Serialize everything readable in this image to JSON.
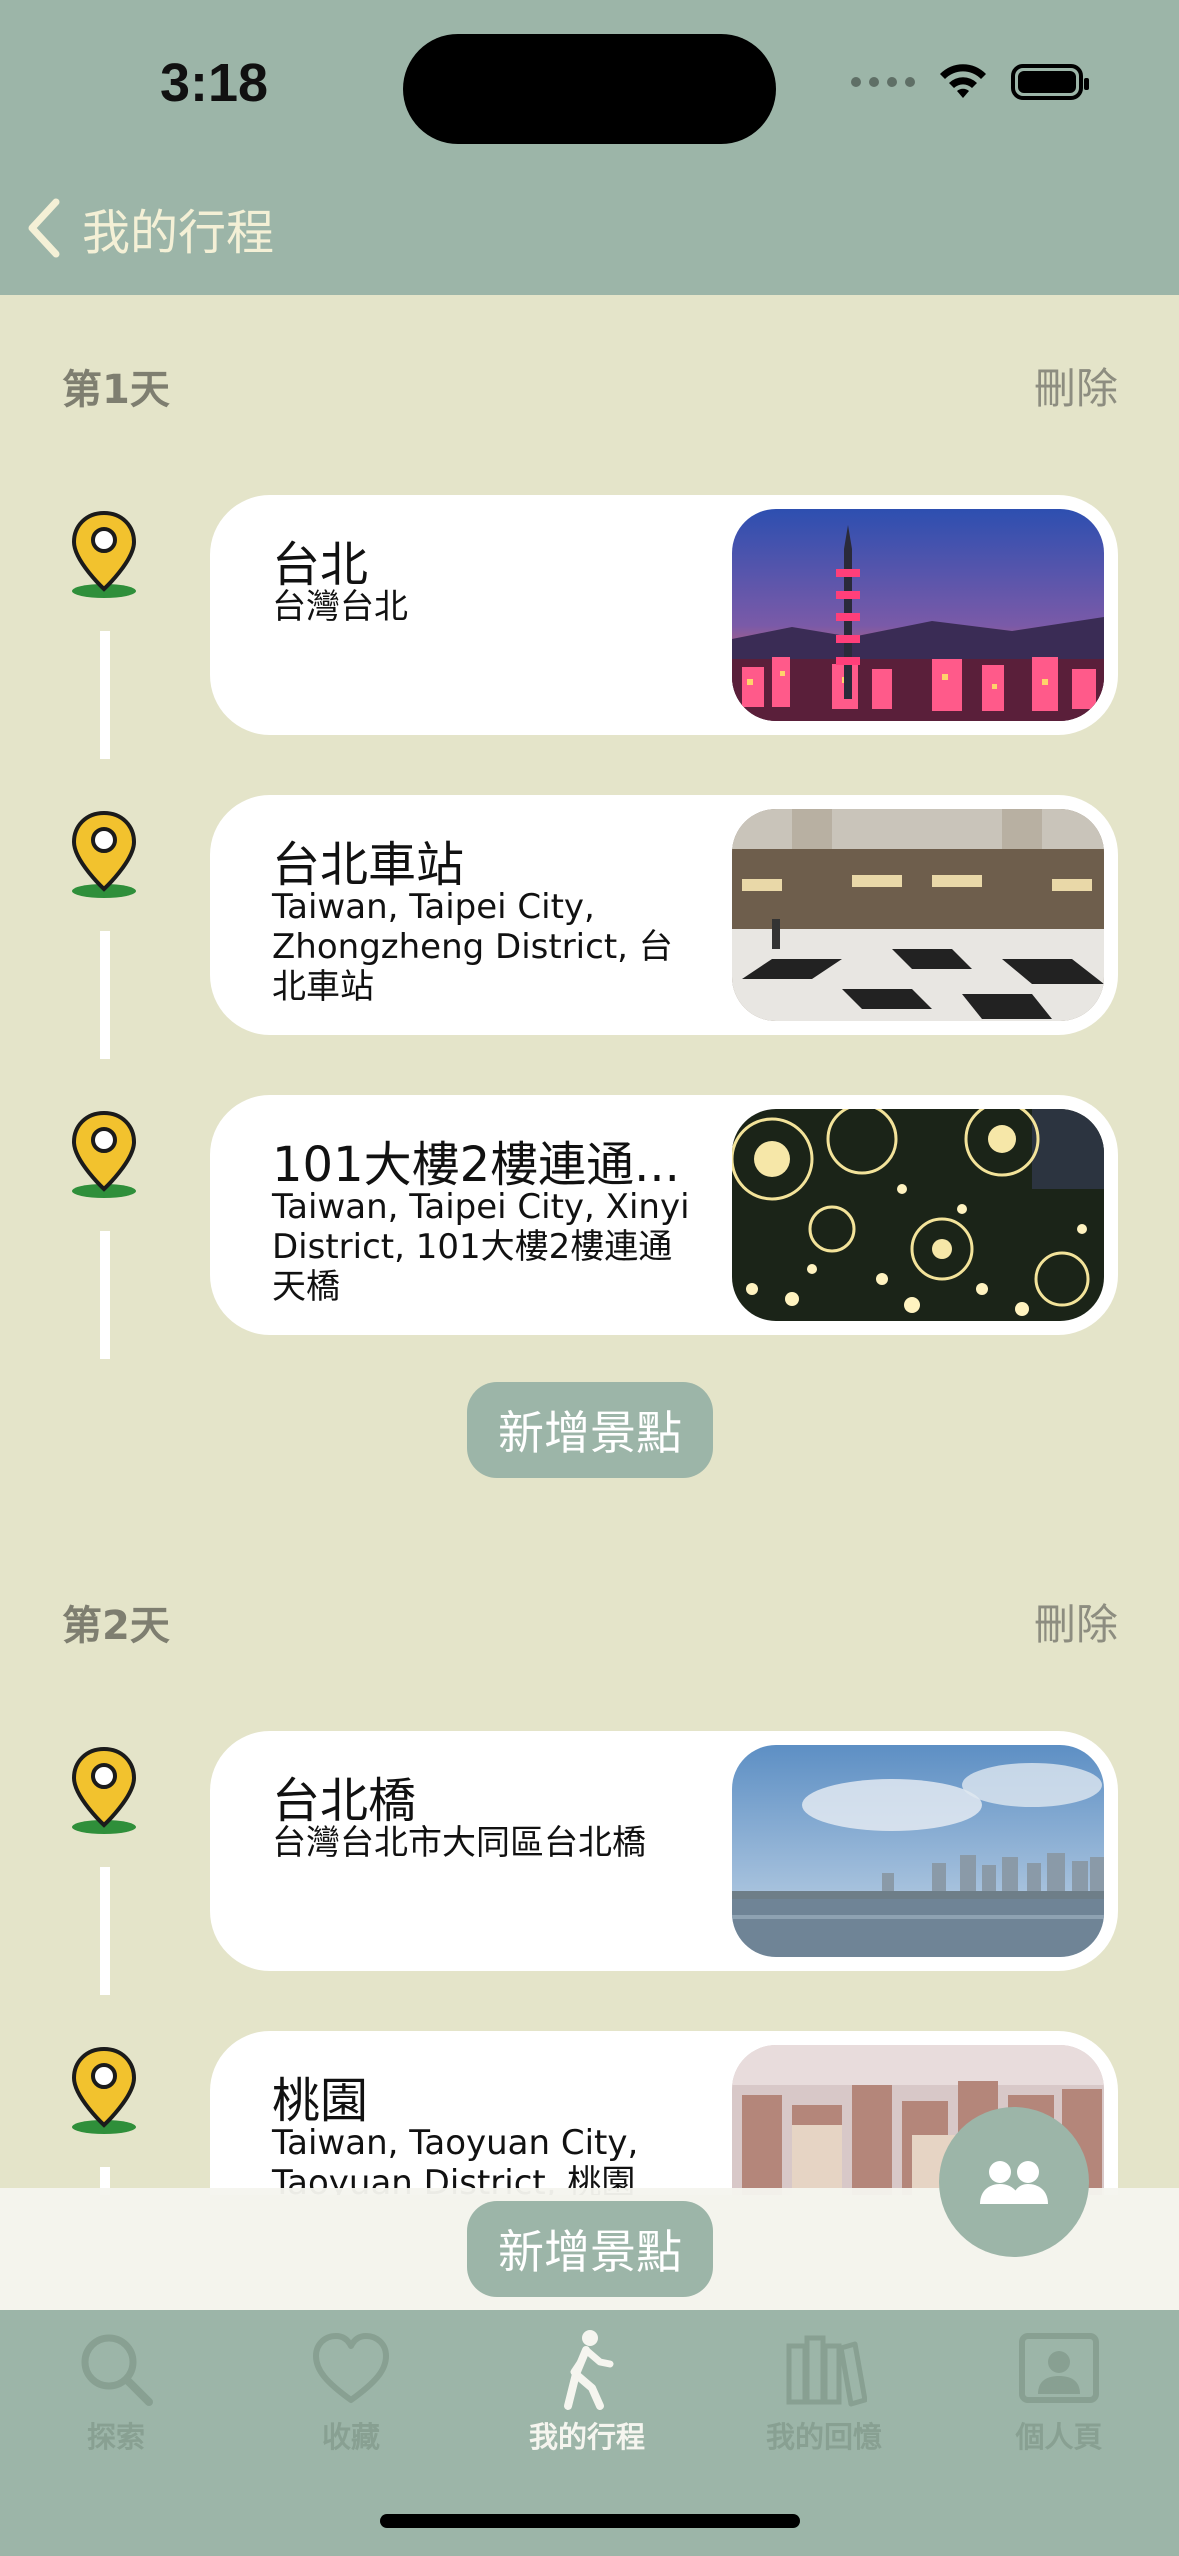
{
  "status_bar": {
    "time": "3:18"
  },
  "nav": {
    "back_label": "我的行程"
  },
  "days": [
    {
      "title": "第1天",
      "delete_label": "刪除",
      "spots": [
        {
          "name": "台北",
          "address": "台灣台北"
        },
        {
          "name": "台北車站",
          "address": "Taiwan, Taipei City, Zhongzheng District, 台北車站"
        },
        {
          "name": "101大樓2樓連通...",
          "address": "Taiwan, Taipei City, Xinyi District, 101大樓2樓連通天橋"
        }
      ],
      "add_label": "新增景點"
    },
    {
      "title": "第2天",
      "delete_label": "刪除",
      "spots": [
        {
          "name": "台北橋",
          "address": "台灣台北市大同區台北橋"
        },
        {
          "name": "桃園",
          "address": "Taiwan, Taoyuan City, Taoyuan District, 桃園"
        }
      ],
      "add_label": "新增景點"
    }
  ],
  "tabs": [
    {
      "label": "探索",
      "icon": "search-icon"
    },
    {
      "label": "收藏",
      "icon": "heart-icon"
    },
    {
      "label": "我的行程",
      "icon": "walking-icon",
      "active": true
    },
    {
      "label": "我的回憶",
      "icon": "books-icon"
    },
    {
      "label": "個人頁",
      "icon": "profile-icon"
    }
  ],
  "colors": {
    "header": "#9cb5a8",
    "background": "#e4e4c9",
    "pin": "#f2c22e",
    "pin_base": "#2f8f3a"
  }
}
